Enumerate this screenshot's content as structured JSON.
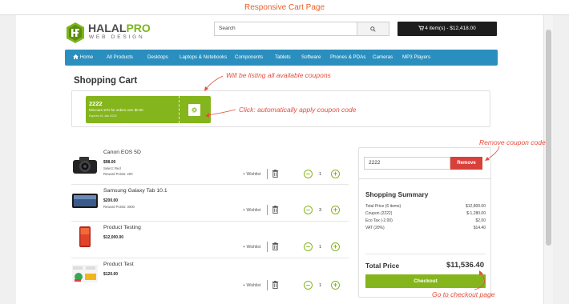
{
  "window_title": "Responsive Cart Page",
  "brand": {
    "name_part1": "HALAL",
    "name_part2": "PRO",
    "tagline": "WEB DESIGN"
  },
  "search": {
    "placeholder": "Search",
    "button_icon": "magnifier-icon"
  },
  "cart_button": {
    "label": "4 item(s) - $12,418.00",
    "icon": "cart-icon"
  },
  "nav": [
    {
      "label": "Home",
      "icon": "home-icon"
    },
    {
      "label": "All Products"
    },
    {
      "label": "Desktops"
    },
    {
      "label": "Laptops & Notebooks"
    },
    {
      "label": "Components"
    },
    {
      "label": "Tablets"
    },
    {
      "label": "Software"
    },
    {
      "label": "Phones & PDAs"
    },
    {
      "label": "Cameras"
    },
    {
      "label": "MP3 Players"
    }
  ],
  "page_heading": "Shopping Cart",
  "annotations": {
    "coupons_list": "Will be listing all available coupons",
    "apply_coupon": "Click: automatically apply coupon code",
    "remove_coupon": "Remove coupon code",
    "checkout": "Go to checkout page"
  },
  "coupon": {
    "code": "2222",
    "description": "Discount 10% for orders over $0.00",
    "expiry": "Expires 01 Jan 2023",
    "apply_icon": "gear-icon"
  },
  "items": [
    {
      "name": "Canon EOS 5D",
      "price": "$98.00",
      "option": "Select: Red",
      "reward": "Reward Points: 200",
      "wishlist": "+ Wishlist",
      "qty": "1",
      "thumb": "camera"
    },
    {
      "name": "Samsung Galaxy Tab 10.1",
      "price": "$200.00",
      "reward": "Reward Points: 3000",
      "wishlist": "+ Wishlist",
      "qty": "3",
      "thumb": "tablet"
    },
    {
      "name": "Product Testing",
      "price": "$12,000.00",
      "wishlist": "+ Wishlist",
      "qty": "1",
      "thumb": "phone"
    },
    {
      "name": "Product Test",
      "price": "$120.00",
      "wishlist": "+ Wishlist",
      "qty": "1",
      "thumb": "promo"
    }
  ],
  "applied_coupon": {
    "value": "2222",
    "remove_label": "Remove"
  },
  "summary": {
    "title": "Shopping Summary",
    "rows": [
      {
        "label": "Total Price (6 items)",
        "value": "$12,800.00"
      },
      {
        "label": "Coupon (2222)",
        "value": "$-1,280.00"
      },
      {
        "label": "Eco Tax (-2.00)",
        "value": "$2.00"
      },
      {
        "label": "VAT (20%)",
        "value": "$14.40"
      }
    ],
    "total_label": "Total Price",
    "total_value": "$11,536.40",
    "checkout_label": "Checkout"
  },
  "colors": {
    "accent_green": "#84b51c",
    "nav_blue": "#2a8fbe",
    "remove_red": "#d9403a",
    "annotation_red": "#e74c3c",
    "title_orange": "#e8612c"
  }
}
